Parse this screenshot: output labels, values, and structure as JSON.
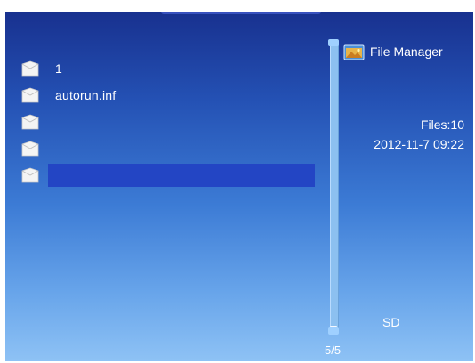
{
  "app": {
    "title": "File Manager",
    "title_icon": "folder-picture-icon"
  },
  "file_list": {
    "items": [
      {
        "name": "1",
        "icon": "file-icon",
        "selected": false
      },
      {
        "name": "autorun.inf",
        "icon": "file-icon",
        "selected": false
      },
      {
        "name": "",
        "icon": "file-icon",
        "selected": false
      },
      {
        "name": "",
        "icon": "file-icon",
        "selected": false
      },
      {
        "name": "",
        "icon": "file-icon",
        "selected": true
      }
    ]
  },
  "status": {
    "files_count": "Files:10",
    "datetime": "2012-11-7 09:22",
    "storage": "SD",
    "page_counter": "5/5"
  },
  "scrollbar": {
    "page": 5,
    "total_pages": 5
  },
  "colors": {
    "selection": "#2345c4",
    "text": "#ffffff",
    "track": "#8cc0f0",
    "thumb": "#f4f8ff"
  }
}
